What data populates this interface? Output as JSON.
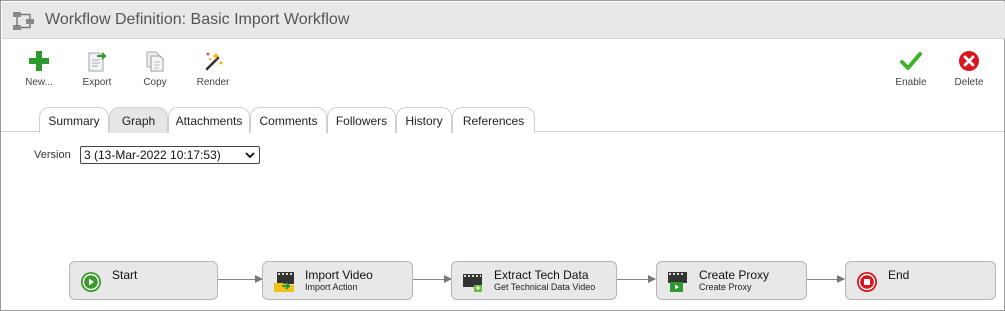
{
  "window": {
    "title": "Workflow Definition: Basic Import Workflow",
    "icon": "workflow-icon"
  },
  "toolbar": {
    "new_label": "New...",
    "export_label": "Export",
    "copy_label": "Copy",
    "render_label": "Render",
    "enable_label": "Enable",
    "delete_label": "Delete"
  },
  "tabs": [
    {
      "label": "Summary",
      "active": false
    },
    {
      "label": "Graph",
      "active": true
    },
    {
      "label": "Attachments",
      "active": false
    },
    {
      "label": "Comments",
      "active": false
    },
    {
      "label": "Followers",
      "active": false
    },
    {
      "label": "History",
      "active": false
    },
    {
      "label": "References",
      "active": false
    }
  ],
  "version": {
    "label": "Version",
    "selected": "3 (13-Mar-2022 10:17:53)"
  },
  "graph": {
    "nodes": [
      {
        "title": "Start",
        "subtitle": "",
        "icon": "play-circle-icon"
      },
      {
        "title": "Import Video",
        "subtitle": "Import Action",
        "icon": "import-video-icon"
      },
      {
        "title": "Extract Tech Data",
        "subtitle": "Get Technical Data Video",
        "icon": "extract-tech-data-icon"
      },
      {
        "title": "Create Proxy",
        "subtitle": "Create Proxy",
        "icon": "create-proxy-icon"
      },
      {
        "title": "End",
        "subtitle": "",
        "icon": "stop-circle-icon"
      }
    ]
  },
  "colors": {
    "green": "#2e9a2e",
    "red": "#d9161e",
    "node_bg": "#e8e8e8"
  }
}
